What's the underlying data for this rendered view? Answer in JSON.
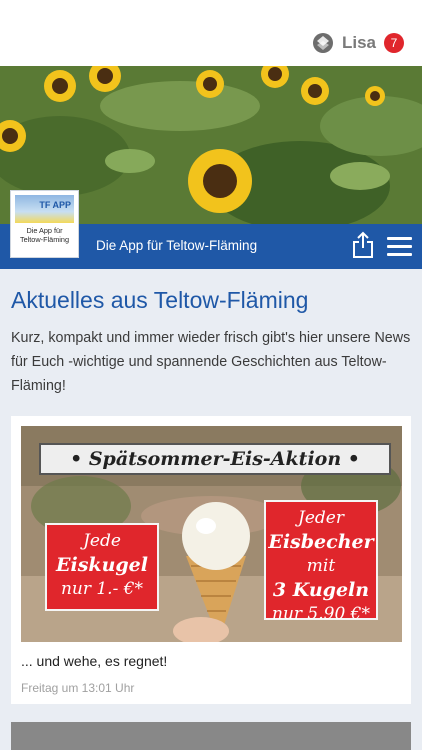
{
  "header": {
    "user_name": "Lisa",
    "notification_count": "7",
    "user_icon": "network-icon"
  },
  "brand": {
    "tagline": "Die App für Teltow-Fläming",
    "logo_text": "TF APP",
    "logo_subtitle_line1": "Die App für",
    "logo_subtitle_line2": "Teltow-Fläming",
    "share_icon": "share-icon",
    "menu_icon": "hamburger-menu-icon",
    "accent_color": "#1f58a7",
    "badge_color": "#e0262c"
  },
  "main": {
    "title": "Aktuelles aus Teltow-Fläming",
    "intro": "Kurz, kompakt und immer wieder frisch gibt's hier unsere News für Euch -wichtige und spannende Geschichten aus Teltow-Fläming!"
  },
  "news": [
    {
      "banner": "• Spätsommer-Eis-Aktion •",
      "offer_left": [
        "Jede",
        "Eiskugel",
        "nur 1.- €*"
      ],
      "offer_right": [
        "Jeder",
        "Eisbecher",
        "mit",
        "3 Kugeln",
        "nur 5.90 €*"
      ],
      "caption": "... und wehe, es regnet!",
      "time": "Freitag um 13:01 Uhr"
    }
  ]
}
